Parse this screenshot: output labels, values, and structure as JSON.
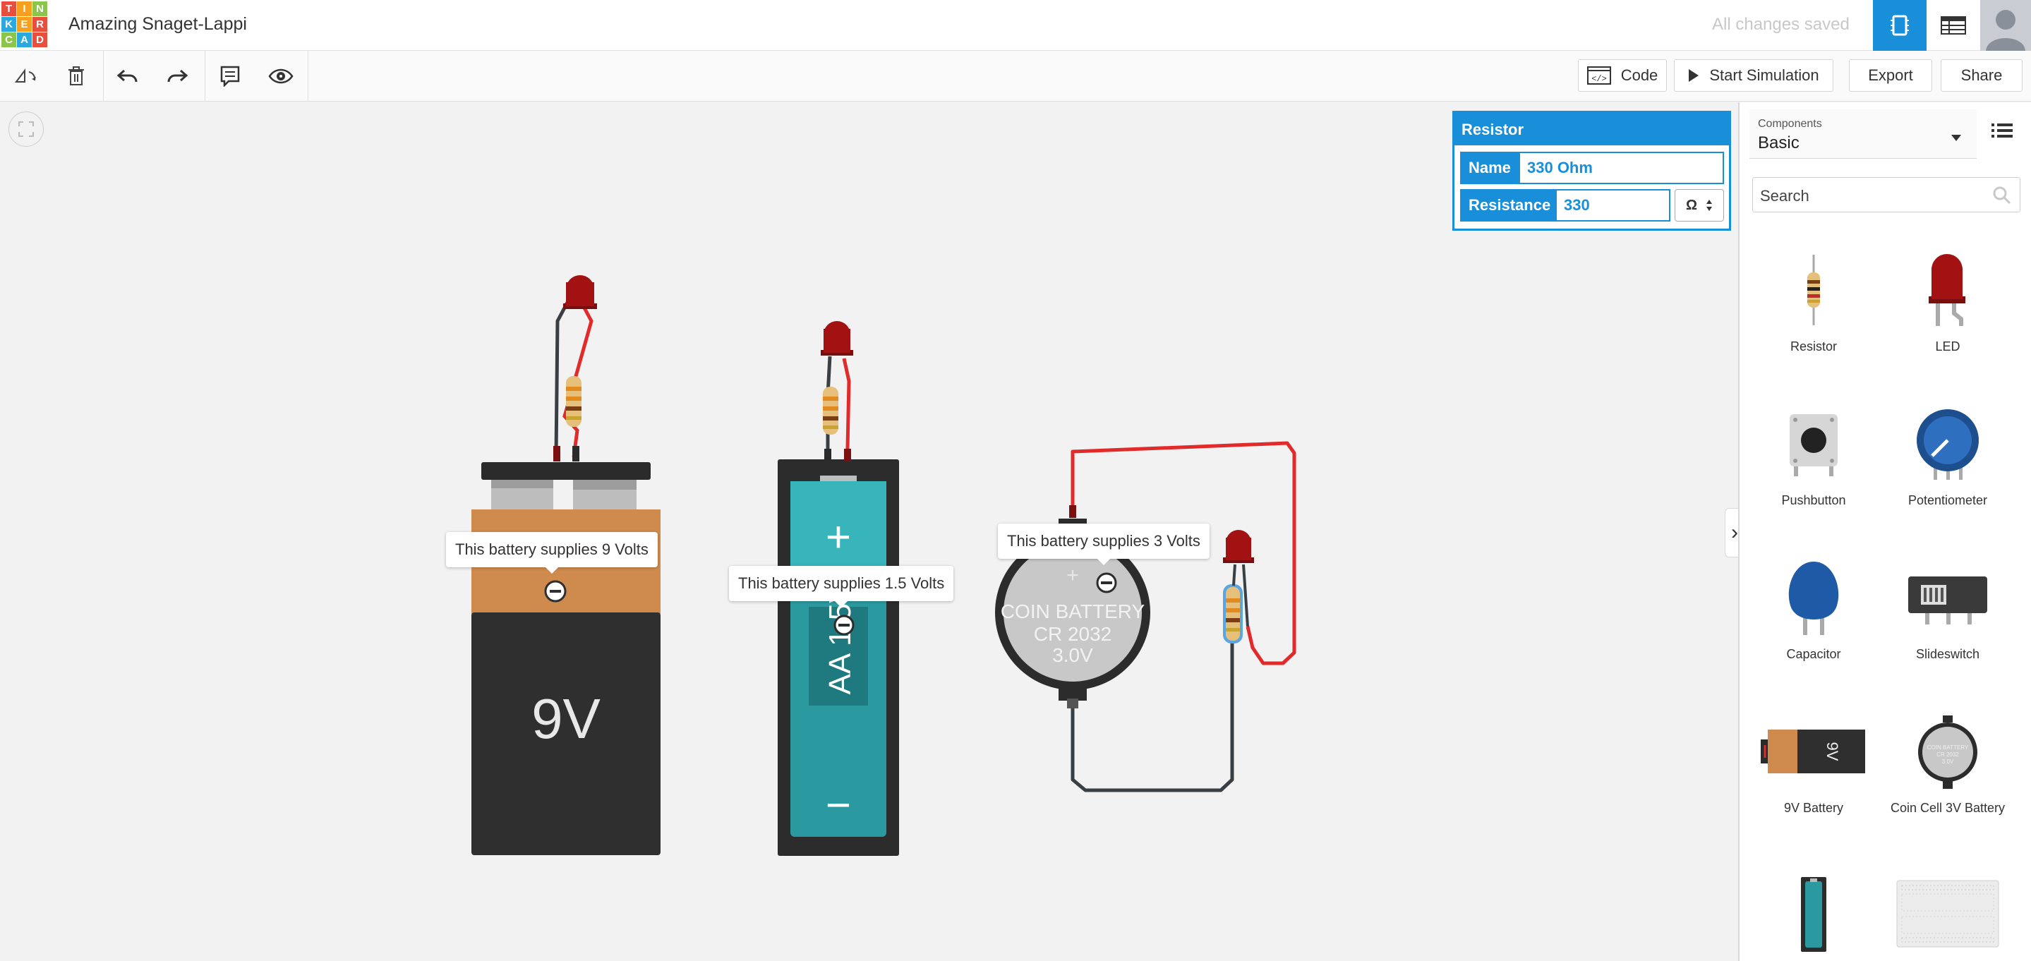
{
  "header": {
    "logo_letters": [
      "T",
      "I",
      "N",
      "K",
      "E",
      "R",
      "C",
      "A",
      "D"
    ],
    "logo_colors": [
      "#e94e3c",
      "#f7a01f",
      "#8bc54a",
      "#29a9df",
      "#f7a01f",
      "#e94e3c",
      "#8bc54a",
      "#29a9df",
      "#e94e3c"
    ],
    "title": "Amazing Snaget-Lappi",
    "save_status": "All changes saved"
  },
  "toolbar": {
    "code_label": "Code",
    "start_sim_label": "Start Simulation",
    "export_label": "Export",
    "share_label": "Share"
  },
  "inspector": {
    "title": "Resistor",
    "name_label": "Name",
    "name_value": "330 Ohm",
    "resistance_label": "Resistance",
    "resistance_value": "330",
    "unit": "Ω"
  },
  "canvas": {
    "tip_9v": "This battery supplies 9 Volts",
    "tip_aa": "This battery supplies 1.5 Volts",
    "tip_coin": "This battery supplies 3 Volts",
    "label_9v": "9V",
    "label_aa": "AA 1.5V",
    "coin_line1": "COIN BATTERY",
    "coin_line2": "CR 2032",
    "coin_line3": "3.0V",
    "aa_plus": "+",
    "aa_minus": "−"
  },
  "panel": {
    "components_label": "Components",
    "components_value": "Basic",
    "search_placeholder": "Search",
    "items": [
      {
        "label": "Resistor"
      },
      {
        "label": "LED"
      },
      {
        "label": "Pushbutton"
      },
      {
        "label": "Potentiometer"
      },
      {
        "label": "Capacitor"
      },
      {
        "label": "Slideswitch"
      },
      {
        "label": "9V Battery"
      },
      {
        "label": "Coin Cell 3V Battery"
      }
    ],
    "battery_icon_label": "9V",
    "coin_icon_line1": "COIN BATTERY",
    "coin_icon_line2": "CR 2032",
    "coin_icon_line3": "3.0V"
  },
  "colors": {
    "accent": "#1a8fd9",
    "wire_red": "#e12b2b",
    "wire_dark": "#3a3f44",
    "led_red": "#a31212",
    "battery_orange": "#cf8b4e",
    "battery_dark": "#2f2f2f",
    "aa_teal": "#2b9aa0"
  }
}
